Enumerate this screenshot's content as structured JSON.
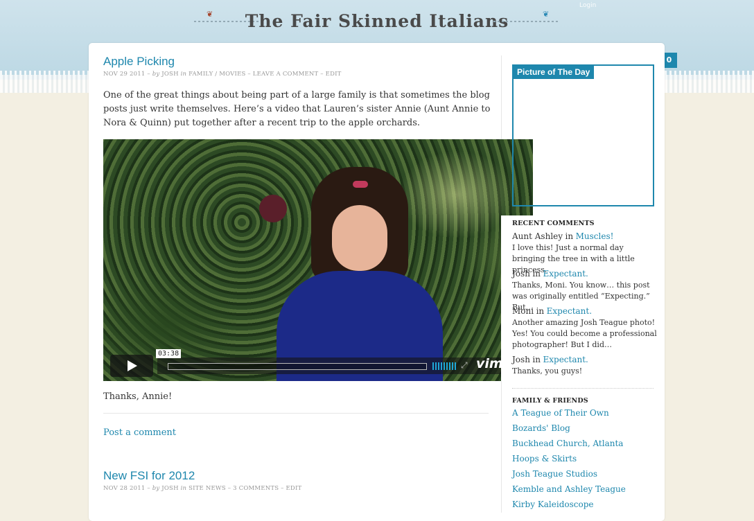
{
  "site": {
    "title": "The Fair Skinned Italians",
    "login": "Login",
    "badge_count": "0"
  },
  "posts": [
    {
      "title": "Apple Picking",
      "date": "NOV 29 2011",
      "sep1": " – ",
      "by": "by",
      "author": "JOSH",
      "in": "in",
      "categories": "FAMILY / MOVIES",
      "comment_link": "LEAVE A COMMENT",
      "edit": "EDIT",
      "body": "One of the great things about being part of a large family is that sometimes the blog posts just write themselves. Here’s a video that Lauren’s sister Annie (Aunt Annie to Nora & Quinn) put together after a recent trip to the apple orchards.",
      "after_video": "Thanks, Annie!",
      "post_comment": "Post a comment",
      "video": {
        "time": "03:38",
        "brand": "vim",
        "progress": 0
      }
    },
    {
      "title": "New FSI for 2012",
      "date": "NOV 28 2011",
      "sep1": " – ",
      "by": "by",
      "author": "JOSH",
      "in": "in",
      "categories": "SITE NEWS",
      "comment_link": "3 COMMENTS",
      "edit": "EDIT"
    }
  ],
  "sidebar": {
    "picture_of_day_title": "Picture of The Day",
    "recent_comments_heading": "RECENT COMMENTS",
    "in_word": "in",
    "comments": [
      {
        "author": "Aunt Ashley",
        "post": "Muscles!",
        "text": "I love this! Just a normal day bringing the tree in with a little princess."
      },
      {
        "author": "Josh",
        "post": "Expectant.",
        "text": "Thanks, Moni. You know… this post was originally entitled “Expecting.” But…"
      },
      {
        "author": "Moni",
        "post": "Expectant.",
        "text": "Another amazing Josh Teague photo! Yes! You could become a professional photographer! But I did…"
      },
      {
        "author": "Josh",
        "post": "Expectant.",
        "text": "Thanks, you guys!"
      }
    ],
    "friends_heading": "FAMILY & FRIENDS",
    "friends": [
      "A Teague of Their Own",
      "Bozards' Blog",
      "Buckhead Church, Atlanta",
      "Hoops & Skirts",
      "Josh Teague Studios",
      "Kemble and Ashley Teague",
      "Kirby Kaleidoscope"
    ]
  },
  "colors": {
    "accent": "#1e87ad",
    "sky": "#cfe3ec",
    "ground": "#f3efe2"
  }
}
